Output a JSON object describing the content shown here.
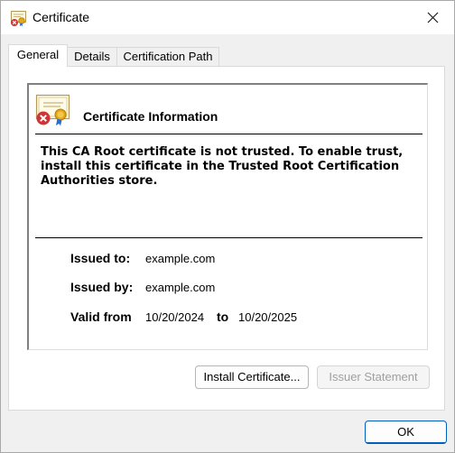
{
  "window": {
    "title": "Certificate",
    "icon": "certificate-error-icon",
    "close_icon": "close-icon"
  },
  "tabs": [
    {
      "label": "General",
      "active": true
    },
    {
      "label": "Details",
      "active": false
    },
    {
      "label": "Certification Path",
      "active": false
    }
  ],
  "general": {
    "heading": "Certificate Information",
    "heading_icon": "certificate-error-icon",
    "warning": "This CA Root certificate is not trusted. To enable trust, install this certificate in the Trusted Root Certification Authorities store.",
    "issued_to_label": "Issued to:",
    "issued_to_value": "example.com",
    "issued_by_label": "Issued by:",
    "issued_by_value": "example.com",
    "valid_from_label": "Valid from",
    "valid_from_value": "10/20/2024",
    "valid_to_label": "to",
    "valid_to_value": "10/20/2025"
  },
  "buttons": {
    "install_certificate": "Install Certificate...",
    "issuer_statement": "Issuer Statement",
    "issuer_statement_enabled": false,
    "ok": "OK"
  },
  "colors": {
    "accent": "#005fb8",
    "error_badge": "#d13438",
    "seal": "#e6a817"
  }
}
